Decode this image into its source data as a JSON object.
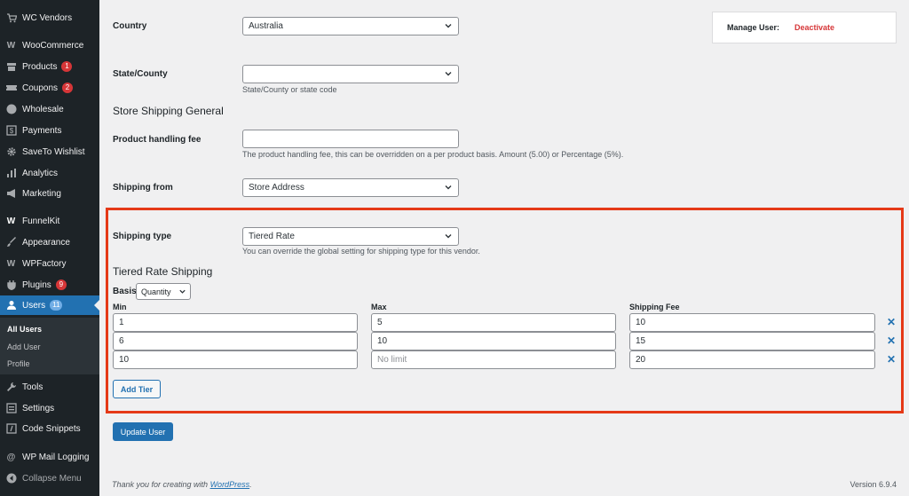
{
  "sidebar": {
    "items": [
      {
        "label": "WC Vendors",
        "icon": "cart-icon"
      },
      {
        "label": "WooCommerce",
        "icon": "woo-icon"
      },
      {
        "label": "Products",
        "icon": "archive-icon",
        "badge": "1"
      },
      {
        "label": "Coupons",
        "icon": "ticket-icon",
        "badge": "2"
      },
      {
        "label": "Wholesale",
        "icon": "circle-icon"
      },
      {
        "label": "Payments",
        "icon": "dollar-icon"
      },
      {
        "label": "SaveTo Wishlist",
        "icon": "gear-icon"
      },
      {
        "label": "Analytics",
        "icon": "bar-chart-icon"
      },
      {
        "label": "Marketing",
        "icon": "megaphone-icon"
      },
      {
        "label": "FunnelKit",
        "icon": "funnelkit-icon"
      },
      {
        "label": "Appearance",
        "icon": "brush-icon"
      },
      {
        "label": "WPFactory",
        "icon": "wpfactory-icon"
      },
      {
        "label": "Plugins",
        "icon": "plug-icon",
        "badge": "9"
      },
      {
        "label": "Users",
        "icon": "user-icon",
        "badge": "11"
      },
      {
        "label": "Tools",
        "icon": "wrench-icon"
      },
      {
        "label": "Settings",
        "icon": "sliders-icon"
      },
      {
        "label": "Code Snippets",
        "icon": "code-icon"
      },
      {
        "label": "WP Mail Logging",
        "icon": "at-icon"
      },
      {
        "label": "Collapse Menu",
        "icon": "collapse-icon"
      }
    ],
    "submenu": [
      "All Users",
      "Add User",
      "Profile"
    ]
  },
  "form": {
    "country_label": "Country",
    "country_value": "Australia",
    "state_label": "State/County",
    "state_value": "",
    "state_help": "State/County or state code",
    "section_title": "Store Shipping General",
    "handling_label": "Product handling fee",
    "handling_value": "",
    "handling_help": "The product handling fee, this can be overridden on a per product basis. Amount (5.00) or Percentage (5%).",
    "shipping_from_label": "Shipping from",
    "shipping_from_value": "Store Address",
    "shipping_type_label": "Shipping type",
    "shipping_type_value": "Tiered Rate",
    "shipping_type_help": "You can override the global setting for shipping type for this vendor.",
    "tiered_title": "Tiered Rate Shipping",
    "basis_label": "Basis",
    "basis_value": "Quantity",
    "columns": [
      "Min",
      "Max",
      "Shipping Fee"
    ],
    "tiers": [
      {
        "min": "1",
        "max": "5",
        "fee": "10"
      },
      {
        "min": "6",
        "max": "10",
        "fee": "15"
      },
      {
        "min": "10",
        "max": "",
        "max_placeholder": "No limit",
        "fee": "20"
      }
    ],
    "remove_glyph": "✕",
    "add_tier_label": "Add Tier",
    "update_label": "Update User"
  },
  "manage": {
    "label": "Manage User:",
    "action": "Deactivate"
  },
  "footer": {
    "thanks_prefix": "Thank you for creating with ",
    "thanks_link": "WordPress",
    "thanks_suffix": ".",
    "version": "Version 6.9.4"
  },
  "colors": {
    "sidebar_bg": "#1d2327",
    "accent": "#2271b1",
    "highlight_frame": "#e53917",
    "danger": "#d63638"
  }
}
